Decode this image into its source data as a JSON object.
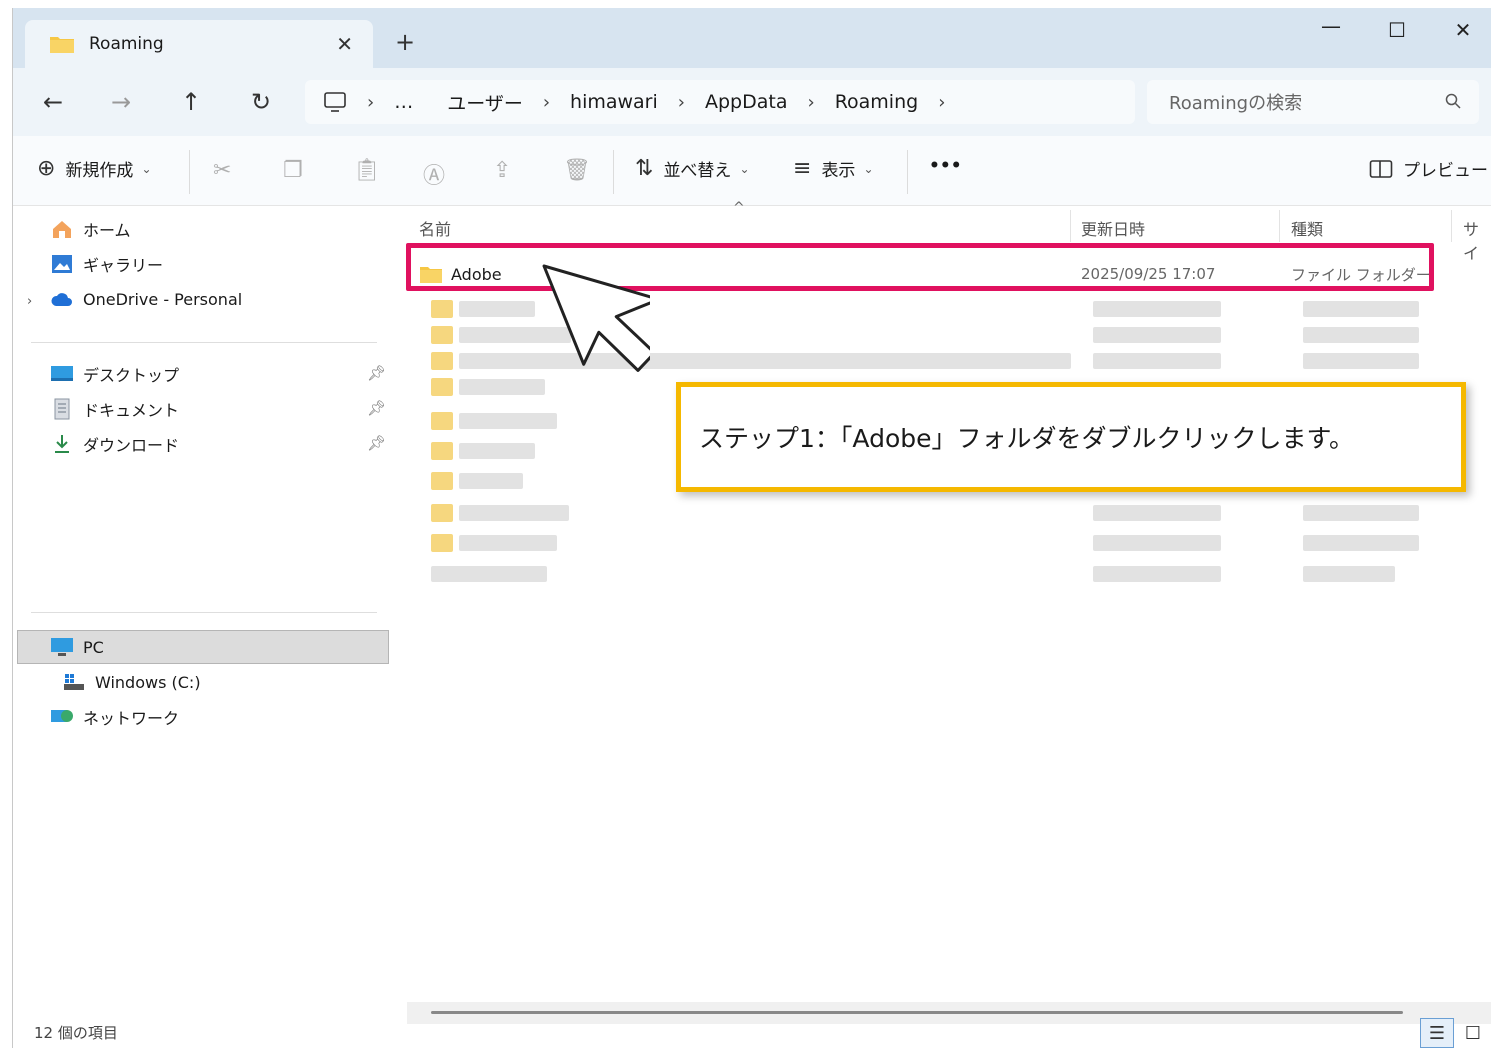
{
  "window": {
    "tab_title": "Roaming",
    "new_tab": "+",
    "minimize": "—",
    "maximize": "☐",
    "close": "✕"
  },
  "nav": {
    "back": "←",
    "forward": "→",
    "up": "↑",
    "refresh": "↻"
  },
  "address": {
    "more": "…",
    "crumbs": [
      "ユーザー",
      "himawari",
      "AppData",
      "Roaming"
    ],
    "sep": "›"
  },
  "search": {
    "placeholder": "Roamingの検索"
  },
  "toolbar": {
    "new_label": "新規作成",
    "sort_label": "並べ替え",
    "view_label": "表示",
    "more_label": "•••",
    "preview_label": "プレビュー"
  },
  "sidebar": {
    "items": [
      {
        "label": "ホーム"
      },
      {
        "label": "ギャラリー"
      },
      {
        "label": "OneDrive - Personal"
      },
      {
        "label": "デスクトップ"
      },
      {
        "label": "ドキュメント"
      },
      {
        "label": "ダウンロード"
      },
      {
        "label": "PC"
      },
      {
        "label": "Windows (C:)"
      },
      {
        "label": "ネットワーク"
      }
    ]
  },
  "columns": {
    "name": "名前",
    "modified": "更新日時",
    "type": "種類",
    "size": "サイ"
  },
  "files": [
    {
      "name": "Adobe",
      "modified": "2025/09/25 17:07",
      "type": "ファイル フォルダー"
    }
  ],
  "callout": {
    "text": "ステップ1：「Adobe」フォルダをダブルクリックします。"
  },
  "status": {
    "count": "12 個の項目"
  },
  "colors": {
    "highlight": "#e0115f",
    "callout_border": "#f5b800",
    "folder": "#f6c744"
  }
}
